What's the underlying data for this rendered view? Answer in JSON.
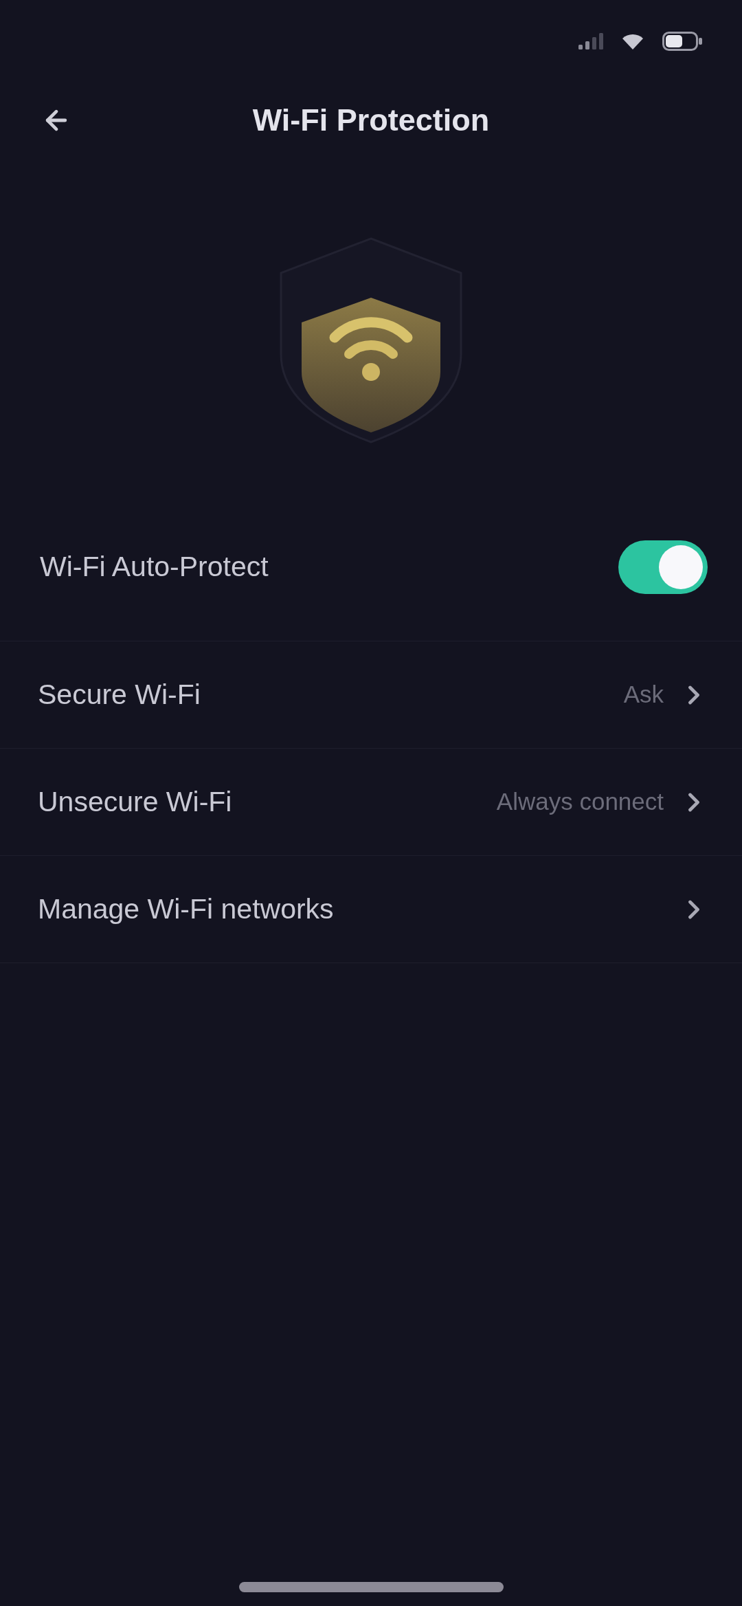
{
  "header": {
    "title": "Wi-Fi Protection"
  },
  "settings": [
    {
      "kind": "toggle",
      "label": "Wi-Fi Auto-Protect",
      "on": true
    },
    {
      "kind": "link",
      "label": "Secure Wi-Fi",
      "value": "Ask"
    },
    {
      "kind": "link",
      "label": "Unsecure Wi-Fi",
      "value": "Always connect"
    },
    {
      "kind": "link",
      "label": "Manage Wi-Fi networks"
    }
  ]
}
